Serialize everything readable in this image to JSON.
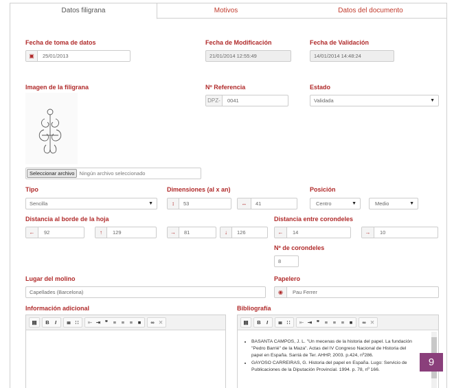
{
  "tabs": [
    {
      "label": "Datos filigrana",
      "active": true
    },
    {
      "label": "Motivos",
      "active": false
    },
    {
      "label": "Datos del documento",
      "active": false
    }
  ],
  "fecha_toma": {
    "label": "Fecha de toma de datos",
    "value": "25/01/2013"
  },
  "fecha_mod": {
    "label": "Fecha de Modificación",
    "value": "21/01/2014 12:55:49"
  },
  "fecha_val": {
    "label": "Fecha de Validación",
    "value": "14/01/2014 14:48:24"
  },
  "imagen": {
    "label": "Imagen de la filigrana",
    "file_button": "Seleccionar archivo",
    "file_status": "Ningún archivo seleccionado"
  },
  "referencia": {
    "label": "Nº Referencia",
    "prefix": "DPZ-",
    "value": "0041"
  },
  "estado": {
    "label": "Estado",
    "value": "Validada"
  },
  "tipo": {
    "label": "Tipo",
    "value": "Sencilla"
  },
  "dimensiones": {
    "label": "Dimensiones (al x an)",
    "alto": "53",
    "ancho": "41"
  },
  "posicion": {
    "label": "Posición",
    "horizontal": "Centro",
    "vertical": "Medio"
  },
  "distancia_borde": {
    "label": "Distancia al borde de la hoja",
    "izquierda": "92",
    "arriba": "129",
    "derecha": "81",
    "abajo": "126"
  },
  "distancia_corondeles": {
    "label": "Distancia entre corondeles",
    "izquierda": "14",
    "derecha": "10"
  },
  "num_corondeles": {
    "label": "Nº de corondeles",
    "value": "8"
  },
  "lugar_molino": {
    "label": "Lugar del molino",
    "value": "Capellades (Barcelona)"
  },
  "papelero": {
    "label": "Papelero",
    "value": "Pau Ferrer"
  },
  "info_adicional": {
    "label": "Información adicional"
  },
  "bibliografia": {
    "label": "Bibliografía",
    "entries": [
      "BASANTA CAMPOS, J. L. \"Un mecenas de la historia del papel. La fundación \"Pedro Barrié\" de la Maza\". Actas del IV Congreso Nacional de Historia del papel en España. Sarriá de Ter. AHHP, 2003. p.424, nº286.",
      "GAYOSO CARREIRAS, G. Historia del papel en España. Lugo: Servicio de Publicaciones de la Diputación Provincial. 1994. p. 78, nº 166."
    ]
  },
  "toolbar": [
    "B",
    "I"
  ],
  "page_number": "9",
  "icons": {
    "calendar": "calendar-icon",
    "up_down": "height-arrow-icon",
    "left_right": "width-arrow-icon",
    "up": "up-arrow-icon",
    "down": "down-arrow-icon",
    "user": "user-icon"
  }
}
